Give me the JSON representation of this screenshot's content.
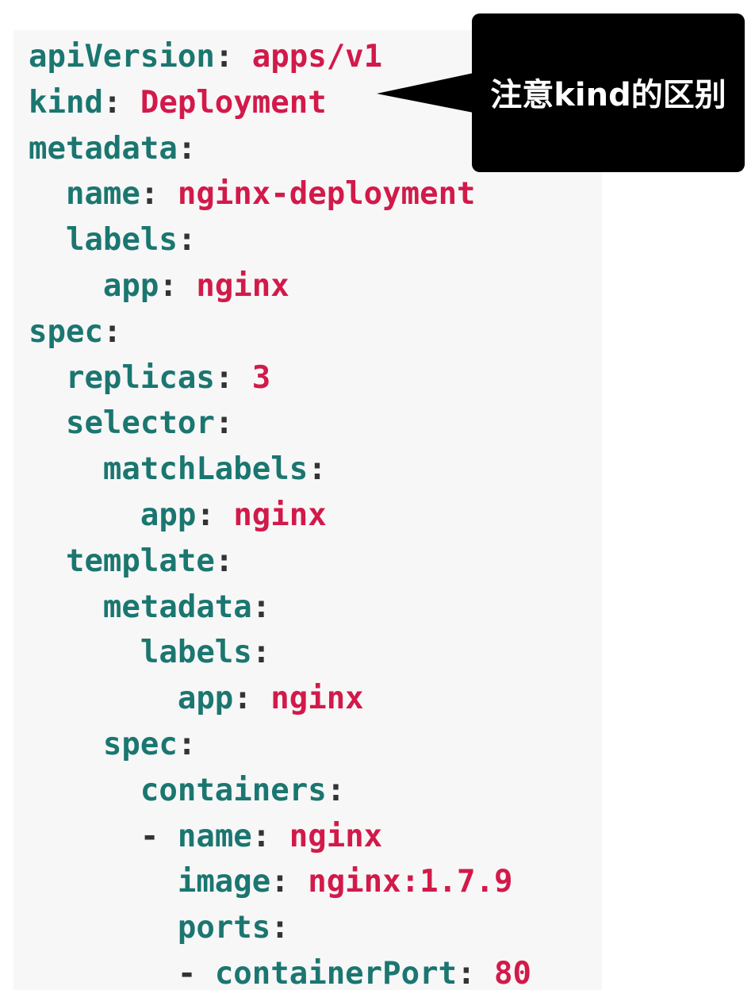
{
  "yaml_lines": [
    {
      "indent": "",
      "dash": "",
      "key": "apiVersion",
      "value": "apps/v1"
    },
    {
      "indent": "",
      "dash": "",
      "key": "kind",
      "value": "Deployment"
    },
    {
      "indent": "",
      "dash": "",
      "key": "metadata",
      "value": ""
    },
    {
      "indent": "  ",
      "dash": "",
      "key": "name",
      "value": "nginx-deployment"
    },
    {
      "indent": "  ",
      "dash": "",
      "key": "labels",
      "value": ""
    },
    {
      "indent": "    ",
      "dash": "",
      "key": "app",
      "value": "nginx"
    },
    {
      "indent": "",
      "dash": "",
      "key": "spec",
      "value": ""
    },
    {
      "indent": "  ",
      "dash": "",
      "key": "replicas",
      "value": "3"
    },
    {
      "indent": "  ",
      "dash": "",
      "key": "selector",
      "value": ""
    },
    {
      "indent": "    ",
      "dash": "",
      "key": "matchLabels",
      "value": ""
    },
    {
      "indent": "      ",
      "dash": "",
      "key": "app",
      "value": "nginx"
    },
    {
      "indent": "  ",
      "dash": "",
      "key": "template",
      "value": ""
    },
    {
      "indent": "    ",
      "dash": "",
      "key": "metadata",
      "value": ""
    },
    {
      "indent": "      ",
      "dash": "",
      "key": "labels",
      "value": ""
    },
    {
      "indent": "        ",
      "dash": "",
      "key": "app",
      "value": "nginx"
    },
    {
      "indent": "    ",
      "dash": "",
      "key": "spec",
      "value": ""
    },
    {
      "indent": "      ",
      "dash": "",
      "key": "containers",
      "value": ""
    },
    {
      "indent": "      ",
      "dash": "- ",
      "key": "name",
      "value": "nginx"
    },
    {
      "indent": "        ",
      "dash": "",
      "key": "image",
      "value": "nginx:1.7.9"
    },
    {
      "indent": "        ",
      "dash": "",
      "key": "ports",
      "value": ""
    },
    {
      "indent": "        ",
      "dash": "- ",
      "key": "containerPort",
      "value": "80"
    }
  ],
  "callout": {
    "text": "注意kind的区别"
  },
  "colors": {
    "key": "#1b7670",
    "value": "#d21a4a",
    "punctuation": "#333333",
    "panel_background": "#f7f7f7",
    "callout_background": "#000000",
    "callout_text": "#ffffff"
  }
}
